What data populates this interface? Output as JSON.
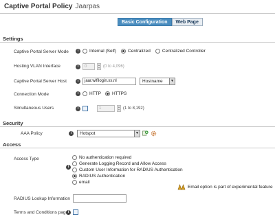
{
  "header": {
    "title": "Captive Portal Policy",
    "subtitle": "Jaarpas"
  },
  "tabs": [
    {
      "label": "Basic Configuration",
      "active": true
    },
    {
      "label": "Web Page",
      "active": false
    }
  ],
  "settings": {
    "section_label": "Settings",
    "server_mode": {
      "label": "Captive Portal Server Mode",
      "options": [
        "Internal (Self)",
        "Centralized",
        "Centralized Controller"
      ],
      "selected": "Centralized"
    },
    "hosting_vlan": {
      "label": "Hosting VLAN Interface",
      "value": "0",
      "hint": "(0 to 4,096)"
    },
    "server_host": {
      "label": "Captive Portal Server Host",
      "value": "jaar.wifilogin.xx.nl",
      "type_value": "Hostname"
    },
    "connection_mode": {
      "label": "Connection Mode",
      "options": [
        "HTTP",
        "HTTPS"
      ],
      "selected": "HTTPS"
    },
    "simultaneous_users": {
      "label": "Simultaneous Users",
      "value": "1",
      "hint": "(1 to 8,192)"
    }
  },
  "security": {
    "section_label": "Security",
    "aaa_policy": {
      "label": "AAA Policy",
      "value": "Hotspot"
    }
  },
  "access": {
    "section_label": "Access",
    "access_type": {
      "label": "Access Type",
      "options": [
        "No authentication required",
        "Generate Logging Record and Allow Access",
        "Custom User Information for RADIUS Authentication",
        "RADIUS Authentication",
        "email"
      ],
      "selected": "RADIUS Authentication"
    },
    "email_note": "Email option is part of experimental feature",
    "radius_lookup": {
      "label": "RADIUS Lookup Information",
      "value": ""
    },
    "terms": {
      "label": "Terms and Conditions page"
    }
  },
  "colors": {
    "accent": "#4a8dbf",
    "tab_inactive": "#e9eef3"
  },
  "icons": [
    "info-icon",
    "add-icon",
    "settings-icon",
    "warning-icon",
    "dropdown-arrow-icon"
  ]
}
